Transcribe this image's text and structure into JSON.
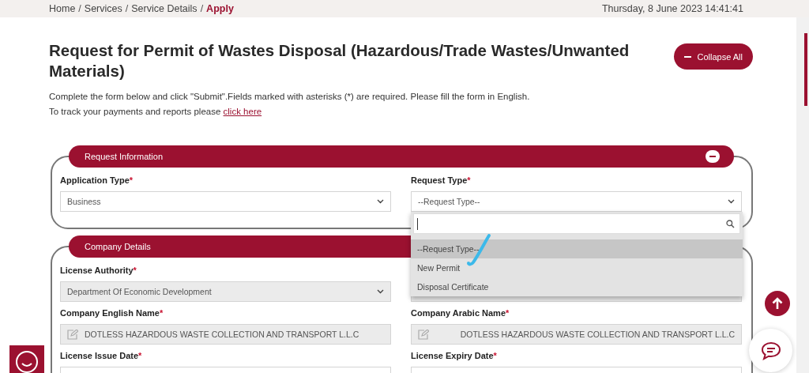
{
  "breadcrumb": [
    {
      "kind": "link",
      "label": "Home",
      "current": false
    },
    {
      "kind": "separator",
      "label": "/"
    },
    {
      "kind": "link",
      "label": "Services",
      "current": false
    },
    {
      "kind": "separator",
      "label": "/"
    },
    {
      "kind": "link",
      "label": "Service Details",
      "current": false
    },
    {
      "kind": "separator",
      "label": "/"
    },
    {
      "kind": "link",
      "label": "Apply",
      "current": true
    }
  ],
  "datetime": "Thursday, 8 June 2023 14:41:41",
  "title": "Request for Permit of Wastes Disposal (Hazardous/Trade Wastes/Unwanted Materials)",
  "collapse_button": "Collapse All",
  "intro": {
    "text": "Complete the form below and click \"Submit\".Fields marked with asterisks (*) are required. Please fill the form in English.",
    "track_text": "To track your payments and reports please",
    "link": "click here"
  },
  "sections": [
    {
      "title": "Request Information",
      "collapse_toggle": true,
      "fields": [
        {
          "kind": "select",
          "label": "Application Type",
          "required_mark": "*",
          "value": "Business",
          "disabled": false
        },
        {
          "kind": "select",
          "label": "Request Type",
          "required_mark": "*",
          "value": "--Request Type--",
          "disabled": false,
          "open": true,
          "options": [
            {
              "label": "--Request Type--",
              "selected": true
            },
            {
              "label": "New Permit",
              "selected": false
            },
            {
              "label": "Disposal Certificate",
              "selected": false
            }
          ]
        }
      ]
    },
    {
      "title": "Company Details",
      "fields": [
        {
          "kind": "select",
          "label": "License Authority",
          "required_mark": "*",
          "value": "Department Of Economic Development",
          "disabled": true
        },
        {
          "kind": "covered",
          "disabled": true
        },
        {
          "kind": "text",
          "label": "Company English Name",
          "required_mark": "*",
          "value": "DOTLESS HAZARDOUS WASTE COLLECTION AND TRANSPORT L.L.C",
          "disabled": true,
          "right_aligned": false
        },
        {
          "kind": "text",
          "label": "Company Arabic Name",
          "required_mark": "*",
          "value": "DOTLESS HAZARDOUS WASTE COLLECTION AND TRANSPORT L.L.C",
          "disabled": true,
          "right_aligned": true
        },
        {
          "kind": "date",
          "label": "License Issue Date",
          "required_mark": "*"
        },
        {
          "kind": "date",
          "label": "License Expiry Date",
          "required_mark": "*"
        }
      ]
    }
  ]
}
